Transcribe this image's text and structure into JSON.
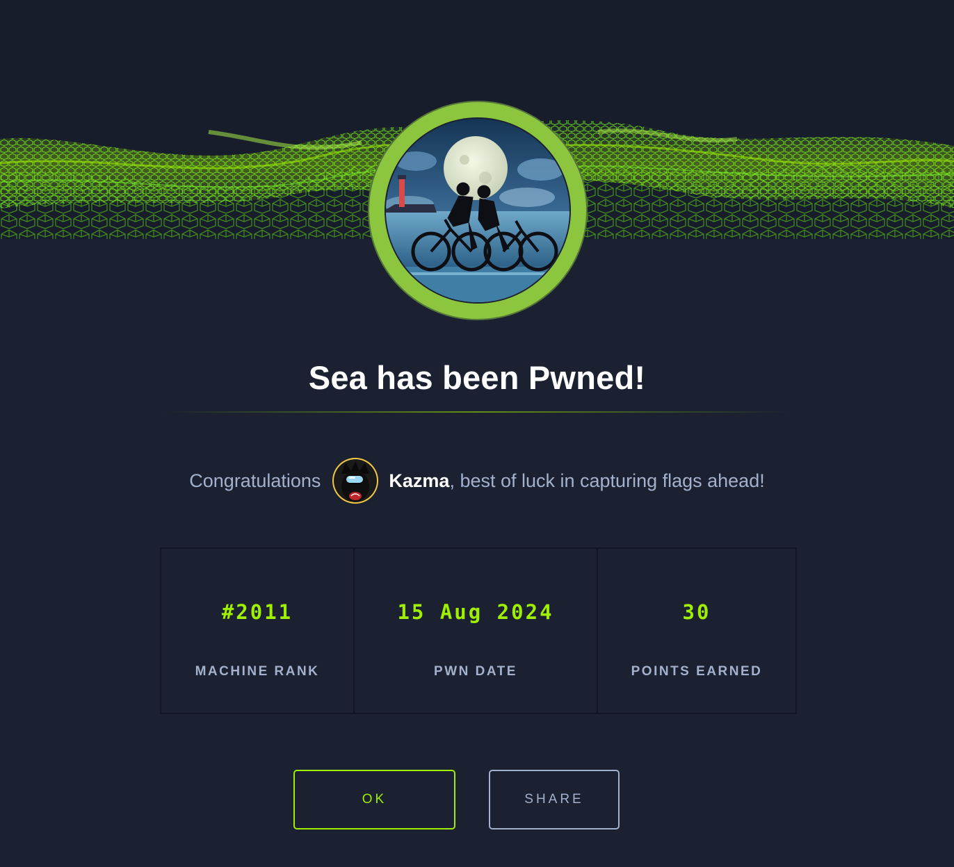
{
  "title": "Sea has been Pwned!",
  "congrats": {
    "prefix": "Congratulations",
    "username": "Kazma",
    "suffix": ", best of luck in capturing flags ahead!"
  },
  "stats": [
    {
      "value": "#2011",
      "label": "MACHINE RANK"
    },
    {
      "value": "15 Aug 2024",
      "label": "PWN DATE"
    },
    {
      "value": "30",
      "label": "POINTS EARNED"
    }
  ],
  "buttons": {
    "ok": "OK",
    "share": "SHARE"
  },
  "colors": {
    "background": "#1b2130",
    "accent": "#9fef00",
    "muted_text": "#a4b1cd",
    "badge_ring": "#8cc63f"
  },
  "icons": {
    "badge": "machine-badge-cyclists-moon",
    "avatar": "user-avatar-crewmate"
  }
}
